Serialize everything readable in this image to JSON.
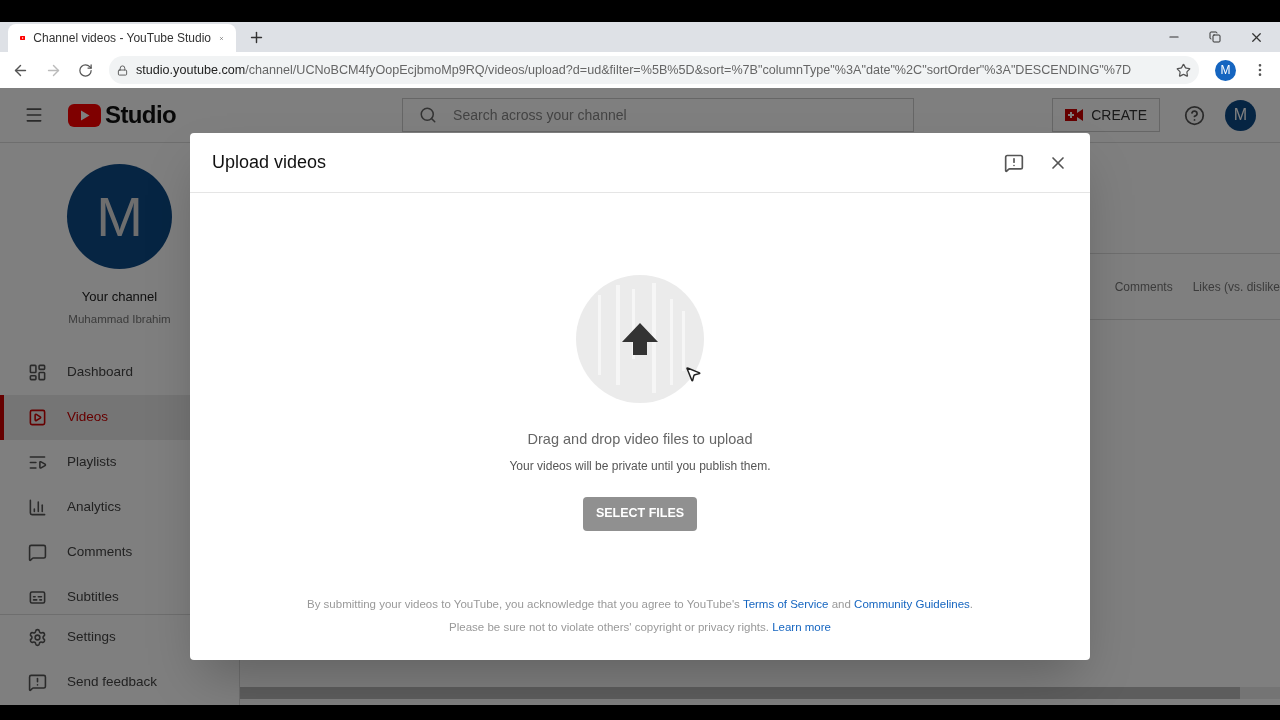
{
  "browser": {
    "tab_title": "Channel videos - YouTube Studio",
    "url_host": "studio.youtube.com",
    "url_path": "/channel/UCNoBCM4fyOopEcjbmoMp9RQ/videos/upload?d=ud&filter=%5B%5D&sort=%7B\"columnType\"%3A\"date\"%2C\"sortOrder\"%3A\"DESCENDING\"%7D",
    "profile_initial": "M"
  },
  "header": {
    "logo": "Studio",
    "search_placeholder": "Search across your channel",
    "create": "CREATE",
    "avatar_initial": "M"
  },
  "sidebar": {
    "avatar_initial": "M",
    "channel_label": "Your channel",
    "channel_name": "Muhammad Ibrahim",
    "items": [
      {
        "label": "Dashboard",
        "selected": false
      },
      {
        "label": "Videos",
        "selected": true
      },
      {
        "label": "Playlists",
        "selected": false
      },
      {
        "label": "Analytics",
        "selected": false
      },
      {
        "label": "Comments",
        "selected": false
      },
      {
        "label": "Subtitles",
        "selected": false
      }
    ],
    "footer_items": [
      {
        "label": "Settings"
      },
      {
        "label": "Send feedback"
      }
    ]
  },
  "table": {
    "columns": [
      "Comments",
      "Likes (vs. dislike"
    ]
  },
  "dialog": {
    "title": "Upload videos",
    "drop_title": "Drag and drop video files to upload",
    "drop_subtitle": "Your videos will be private until you publish them.",
    "button": "SELECT FILES",
    "legal_lines": [
      [
        {
          "kind": "text",
          "text": "By submitting your videos to YouTube, you acknowledge that you agree to YouTube's"
        },
        {
          "kind": "link",
          "text": "Terms of Service"
        },
        {
          "kind": "text",
          "text": "and"
        },
        {
          "kind": "link",
          "text": "Community Guidelines"
        },
        {
          "kind": "text",
          "text": "."
        }
      ],
      [
        {
          "kind": "text",
          "text": "Please be sure not to violate others' copyright or privacy rights."
        },
        {
          "kind": "link",
          "text": "Learn more"
        }
      ]
    ]
  }
}
